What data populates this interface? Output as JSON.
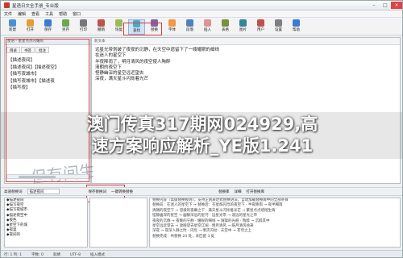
{
  "window": {
    "title": "星语日文全手册_专业版"
  },
  "menu": [
    "文件",
    "编辑",
    "查看",
    "工具",
    "帮助",
    "窗口"
  ],
  "toolbar": [
    {
      "label": "新建",
      "color": "#4a90d9"
    },
    {
      "label": "打开",
      "color": "#e0a030"
    },
    {
      "label": "保存",
      "color": "#3a7bd5"
    },
    {
      "label": "另存",
      "color": "#6aa84f"
    },
    {
      "label": "打印",
      "color": "#777777"
    },
    {
      "label": "撤销",
      "color": "#c0504d"
    },
    {
      "label": "恢复",
      "color": "#9bbb59"
    },
    {
      "label": "查找",
      "color": "#4bacc6"
    },
    {
      "label": "替换",
      "color": "#8064a2"
    },
    {
      "label": "字体",
      "color": "#f79646"
    },
    {
      "label": "段落",
      "color": "#4f81bd"
    },
    {
      "label": "插入",
      "color": "#d99694"
    },
    {
      "label": "表格",
      "color": "#76923c"
    },
    {
      "label": "图片",
      "color": "#31859b"
    },
    {
      "label": "用户",
      "color": "#c0504d"
    },
    {
      "label": "设置",
      "color": "#7f7f7f"
    },
    {
      "label": "帮助",
      "color": "#3a7bd5"
    }
  ],
  "left_panel": {
    "header": "星语 - 星星点点闪耀的",
    "tabs": [
      "目录",
      "书签",
      "批注"
    ],
    "items": [
      "【描述夜间】",
      "【描述夜间】【描述夜空】",
      "【描写夜城市】",
      "【描写夜城市】【描述夜",
      "【描写夜】"
    ]
  },
  "editor": {
    "header": "新文本",
    "lines": [
      "远星光带划破了夜夜的沉静，在天空中遗留下了一缕耀眼的细线",
      "在迷人的星空下",
      "半夜降雨了，明月清风的夜空使人陶醉",
      "清朗的夜空下",
      "怪静幽深的星空远近望去",
      "深夜，满天星斗闪烁着光芒",
      "",
      "",
      "",
      ""
    ]
  },
  "handwriting": {
    "text": "但有间生"
  },
  "bottom_toolbar": {
    "label1": "高速替换词",
    "input_label": "描述夜间",
    "btn1": "保存替换词",
    "btn2": "一键转换替换",
    "btn3": "替换库",
    "btn4": "详细",
    "btn5": "打开替换库"
  },
  "bottom_left": [
    "◆描述夜间",
    "◆描写夜空",
    "◆描写夜城市",
    "◆描述夜空中",
    "◆夜色",
    "◆星空下的城",
    "◆夜里",
    "◆夜间的"
  ],
  "bottom_right": [
    "替换内容（高级替换规则），支持正则表达式替换语法，自动加载替换库中的全部条目",
    "替换前：在迷人的星空下 → 替换后：在星辉闪烁的夜空下 · 半夜降雨 → 夜半细雨",
    "清朗的夜空下 → 澄澈的夜幕之下 · 满天星斗闪烁着光芒 → 繁星点点熠熠生辉",
    "怪静幽深的星空 → 幽静深远的星河 · 远星光带 → 遥远的星光之带",
    "夜夜的沉静 → 夜晚的宁静 · 耀眼的细线 → 璀璨的光痕 · 陶醉 → 沉醉其中",
    "星空远近望去 → 放眼望去星空辽阔 · 明月清风 → 皓月清风徐来",
    "深夜 → 夜深人静之时 · 闪烁 → 明灭闪动 · 天空中 → 苍穹之上",
    "替换完成：共替换 24 处，未匹配 3 处"
  ],
  "status": [
    "行: 1  列: 1",
    "字数: 0",
    "就绪",
    "UTF-8",
    "插入模式"
  ],
  "overlay": {
    "title_line1": "澳门传真317期网024929,高",
    "title_line2": "速方案响应解析_YE版1.241"
  },
  "colors": {
    "accent": "#3a7bd5",
    "annotation_red": "#d63a3a",
    "close": "#e04343"
  }
}
